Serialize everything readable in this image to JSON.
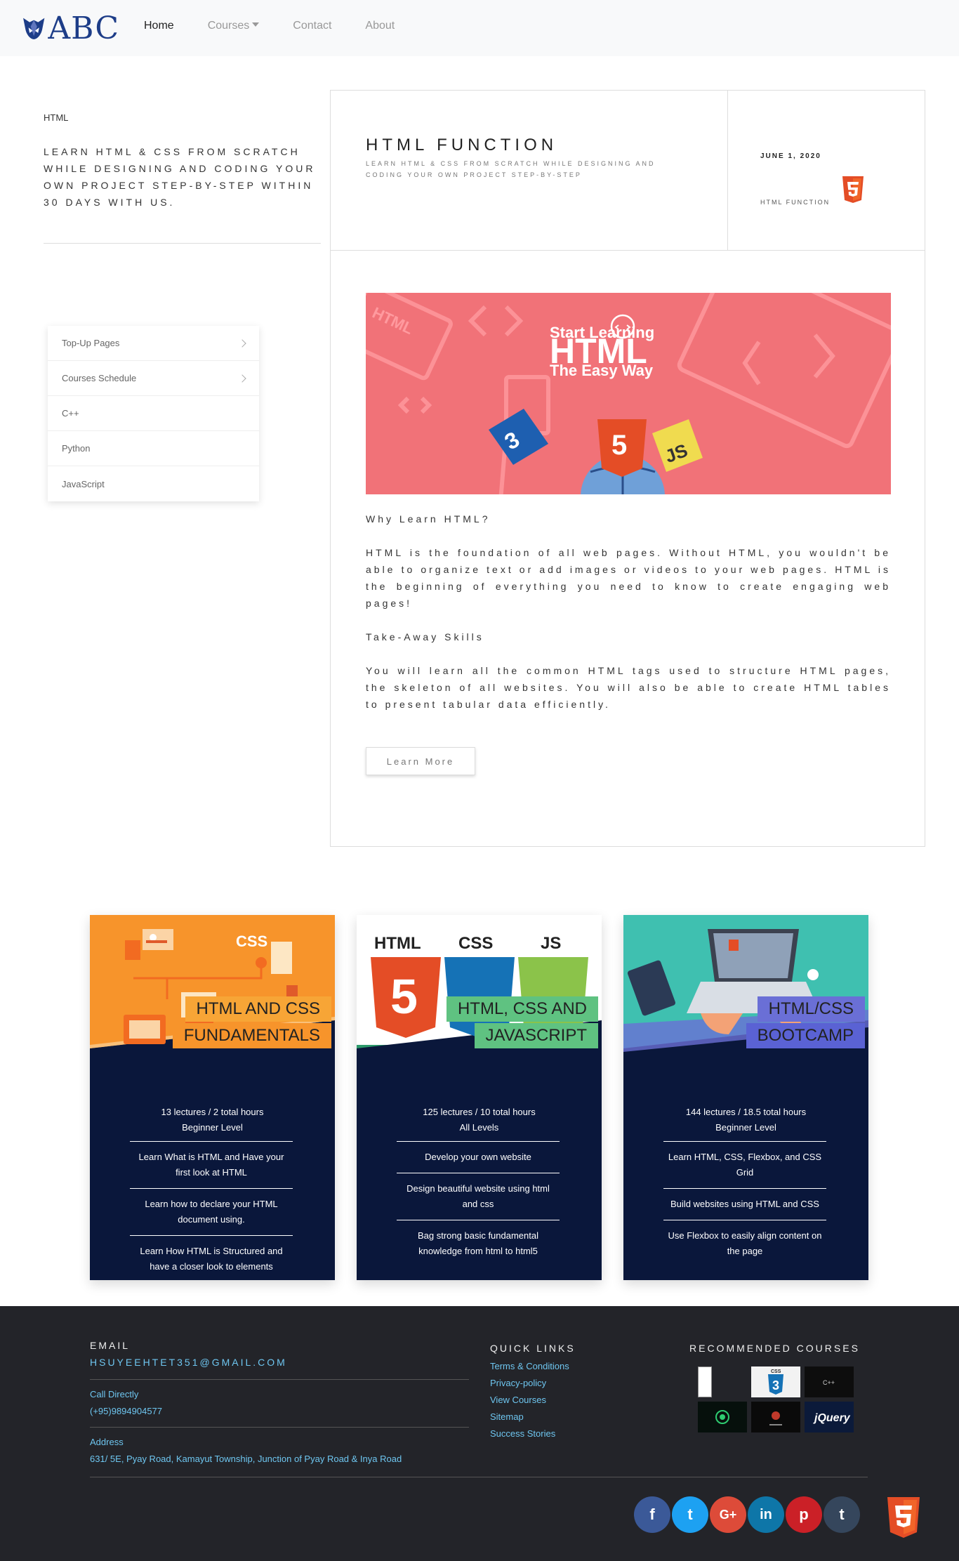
{
  "nav": {
    "logo": "ABC",
    "links": [
      "Home",
      "Courses",
      "Contact",
      "About"
    ]
  },
  "left": {
    "label": "HTML",
    "description": "Learn HTML & CSS from scratch while designing and coding your own project step-by-step within 30 days with us.",
    "menu": [
      "Top-Up Pages",
      "Courses Schedule",
      "C++",
      "Python",
      "JavaScript"
    ]
  },
  "post": {
    "title": "HTML FUNCTION",
    "subtitle": "Learn HTML & CSS from scratch while designing and coding your own project step-by-step",
    "date": "JUNE 1, 2020",
    "tag": "HTML FUNCTION",
    "banner_line1": "Start Learning",
    "banner_line2": "HTML",
    "banner_line3": "The Easy Way",
    "banner_bg_text": "HTML",
    "why_heading": "Why Learn HTML?",
    "why_text": "HTML is the foundation of all web pages. Without HTML, you wouldn't be able to organize text or add images or videos to your web pages. HTML is the beginning of everything you need to know to create engaging web pages!",
    "skills_heading": "Take-Away Skills",
    "skills_text": "You will learn all the common HTML tags used to structure HTML pages, the skeleton of all websites. You will also be able to create HTML tables to present tabular data efficiently.",
    "button": "Learn More"
  },
  "courses": [
    {
      "title1": "HTML AND CSS",
      "title2": "FUNDAMENTALS",
      "stats1": "13 lectures  / 2 total hours",
      "stats2": "Beginner Level",
      "items": [
        "Learn What is HTML and Have your first look at HTML",
        "Learn how to declare your HTML document using.",
        "Learn How HTML is Structured and have a closer look to elements"
      ],
      "img_label": "CSS"
    },
    {
      "title1": "HTML, CSS AND",
      "title2": "JAVASCRIPT",
      "stats1": "125 lectures  / 10 total hours",
      "stats2": "All Levels",
      "items": [
        "Develop your own website",
        "Design beautiful website using html and css",
        "Bag strong basic fundamental knowledge from html to html5"
      ],
      "img_labels": [
        "HTML",
        "CSS",
        "JS"
      ]
    },
    {
      "title1": "HTML/CSS",
      "title2": "BOOTCAMP",
      "stats1": "144 lectures  / 18.5 total hours",
      "stats2": "Beginner Level",
      "items": [
        "Learn HTML, CSS, Flexbox, and CSS Grid",
        "Build websites using HTML and CSS",
        "Use Flexbox to easily align content on the page"
      ]
    }
  ],
  "footer": {
    "email_label": "EMAIL",
    "email": "HSUYEEHTET351@GMAIL.COM",
    "call_label": "Call Directly",
    "phone": "(+95)9894904577",
    "address_label": "Address",
    "address": "631/ 5E, Pyay Road, Kamayut Township, Junction of Pyay Road & Inya Road",
    "quick_links_label": "QUICK LINKS",
    "quick_links": [
      "Terms & Conditions",
      "Privacy-policy",
      "View Courses",
      "Sitemap",
      "Success Stories"
    ],
    "recommended_label": "RECOMMENDED COURSES",
    "rec_labels": [
      "CSS",
      "C++",
      "jQuery"
    ],
    "social": [
      "facebook",
      "twitter",
      "google-plus",
      "linkedin",
      "pinterest",
      "tumblr"
    ],
    "social_glyphs": [
      "f",
      "t",
      "G+",
      "in",
      "p",
      "t"
    ],
    "social_colors": [
      "#3b5998",
      "#1da1f2",
      "#dd4b39",
      "#0e76a8",
      "#cb2027",
      "#35465c"
    ]
  }
}
